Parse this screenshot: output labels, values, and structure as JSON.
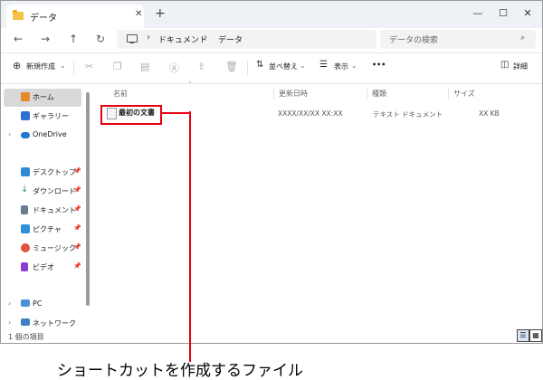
{
  "window": {
    "tab_title": "データ",
    "new_tab_symbol": "+",
    "tab_close_symbol": "✕",
    "controls": {
      "minimize": "—",
      "maximize": "☐",
      "close": "✕"
    }
  },
  "nav": {
    "back": "←",
    "forward": "→",
    "up": "↑",
    "refresh": "↻",
    "breadcrumb": [
      "ドキュメント",
      "データ"
    ],
    "breadcrumb_sep": "›",
    "search_placeholder": "データの検索",
    "search_icon": "⌕"
  },
  "toolbar": {
    "new_label": "新規作成",
    "sort_label": "並べ替え",
    "view_label": "表示",
    "more_label": "•••",
    "details_label": "詳細",
    "icons": [
      "cut-icon",
      "copy-icon",
      "paste-icon",
      "rename-icon",
      "share-icon",
      "delete-icon"
    ]
  },
  "sidebar": {
    "items": [
      {
        "label": "ホーム",
        "icon": "home-icon",
        "color": "#e58a2a"
      },
      {
        "label": "ギャラリー",
        "icon": "gallery-icon",
        "color": "#2f6fd3"
      },
      {
        "label": "OneDrive",
        "icon": "cloud-icon",
        "color": "#1f77d0"
      },
      {
        "label": "デスクトップ",
        "icon": "desktop-icon",
        "color": "#2b8bd6"
      },
      {
        "label": "ダウンロード",
        "icon": "download-icon",
        "color": "#2aa05a"
      },
      {
        "label": "ドキュメント",
        "icon": "documents-icon",
        "color": "#6b7c8f"
      },
      {
        "label": "ピクチャ",
        "icon": "pictures-icon",
        "color": "#2f8fd8"
      },
      {
        "label": "ミュージック",
        "icon": "music-icon",
        "color": "#e0553b"
      },
      {
        "label": "ビデオ",
        "icon": "videos-icon",
        "color": "#8a3fd0"
      },
      {
        "label": "PC",
        "icon": "pc-icon",
        "color": "#4a90d9"
      },
      {
        "label": "ネットワーク",
        "icon": "network-icon",
        "color": "#3f7fbf"
      }
    ]
  },
  "columns": {
    "name": "名前",
    "modified": "更新日時",
    "type": "種類",
    "size": "サイズ"
  },
  "files": [
    {
      "name": "最初の文書",
      "modified": "XXXX/XX/XX XX:XX",
      "type": "テキスト ドキュメント",
      "size": "XX KB"
    }
  ],
  "status": {
    "count": "1 個の項目"
  },
  "caption": "ショートカットを作成するファイル",
  "accent_color": "#e60012"
}
